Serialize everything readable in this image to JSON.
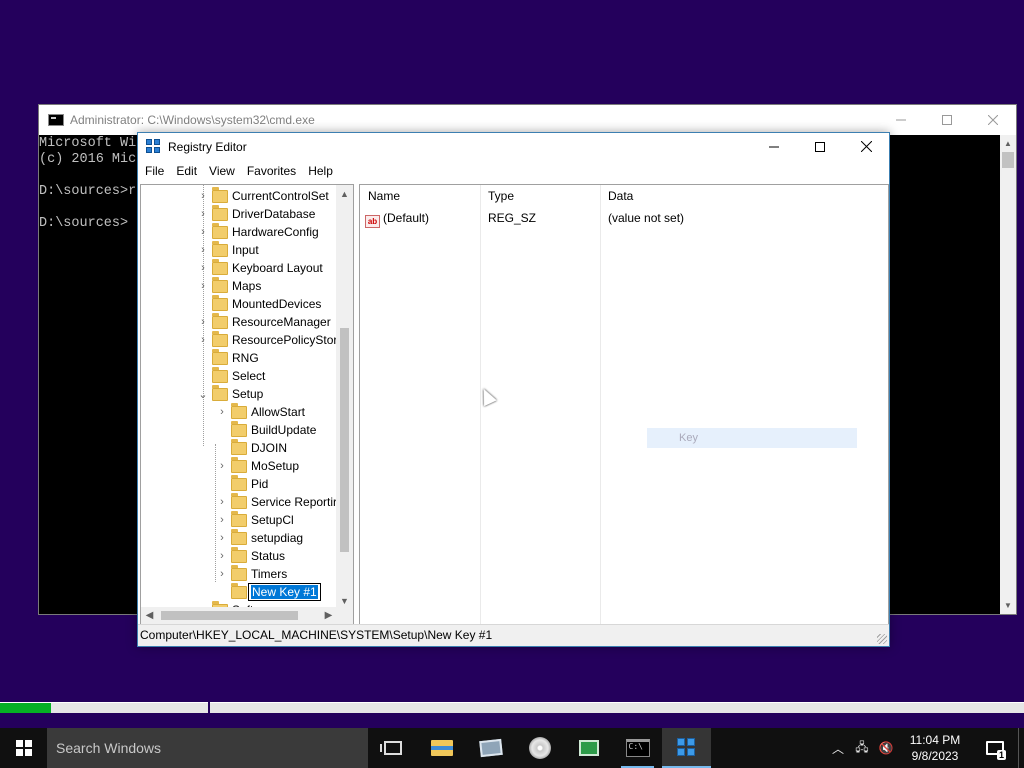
{
  "cmd": {
    "title": "Administrator: C:\\Windows\\system32\\cmd.exe",
    "lines": [
      "Microsoft Wi",
      "(c) 2016 Mic",
      "",
      "D:\\sources>r",
      "",
      "D:\\sources>"
    ]
  },
  "regedit": {
    "title": "Registry Editor",
    "menu": [
      "File",
      "Edit",
      "View",
      "Favorites",
      "Help"
    ],
    "tree": {
      "items": [
        {
          "label": "CurrentControlSet",
          "expander": "›",
          "level": 0
        },
        {
          "label": "DriverDatabase",
          "expander": "›",
          "level": 0
        },
        {
          "label": "HardwareConfig",
          "expander": "›",
          "level": 0
        },
        {
          "label": "Input",
          "expander": "›",
          "level": 0
        },
        {
          "label": "Keyboard Layout",
          "expander": "›",
          "level": 0
        },
        {
          "label": "Maps",
          "expander": "›",
          "level": 0
        },
        {
          "label": "MountedDevices",
          "expander": "",
          "level": 0
        },
        {
          "label": "ResourceManager",
          "expander": "›",
          "level": 0
        },
        {
          "label": "ResourcePolicyStor",
          "expander": "›",
          "level": 0
        },
        {
          "label": "RNG",
          "expander": "",
          "level": 0
        },
        {
          "label": "Select",
          "expander": "",
          "level": 0
        },
        {
          "label": "Setup",
          "expander": "⌄",
          "level": 0
        },
        {
          "label": "AllowStart",
          "expander": "›",
          "level": 1
        },
        {
          "label": "BuildUpdate",
          "expander": "",
          "level": 1
        },
        {
          "label": "DJOIN",
          "expander": "",
          "level": 1
        },
        {
          "label": "MoSetup",
          "expander": "›",
          "level": 1
        },
        {
          "label": "Pid",
          "expander": "",
          "level": 1
        },
        {
          "label": "Service Reportir",
          "expander": "›",
          "level": 1
        },
        {
          "label": "SetupCl",
          "expander": "›",
          "level": 1
        },
        {
          "label": "setupdiag",
          "expander": "›",
          "level": 1
        },
        {
          "label": "Status",
          "expander": "›",
          "level": 1
        },
        {
          "label": "Timers",
          "expander": "›",
          "level": 1
        }
      ],
      "editing_item": "New Key #1",
      "partial_item": "Software"
    },
    "list": {
      "columns": [
        "Name",
        "Type",
        "Data"
      ],
      "rows": [
        {
          "name": "(Default)",
          "type": "REG_SZ",
          "data": "(value not set)"
        }
      ],
      "drag_ghost": "Key"
    },
    "status": "Computer\\HKEY_LOCAL_MACHINE\\SYSTEM\\Setup\\New Key #1"
  },
  "progress": {
    "value_percent": 5
  },
  "taskbar": {
    "search_placeholder": "Search Windows",
    "time": "11:04 PM",
    "date": "9/8/2023",
    "notification_count": "1"
  }
}
